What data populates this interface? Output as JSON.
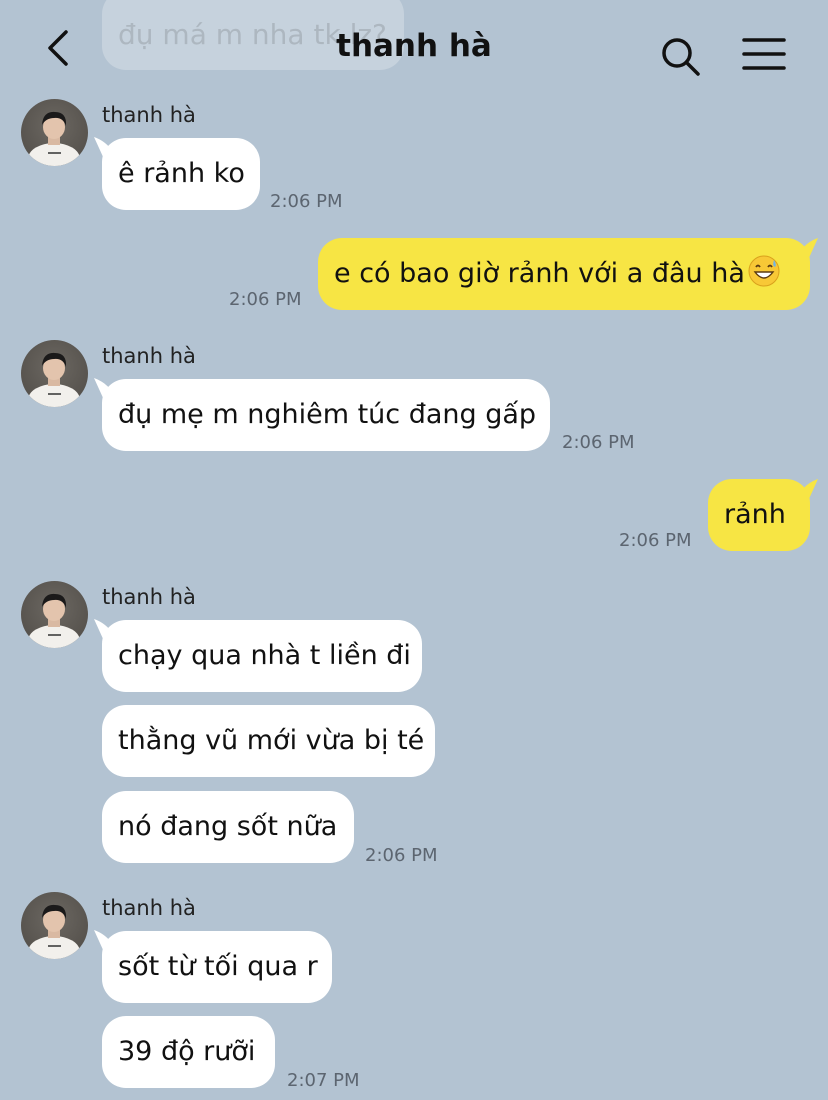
{
  "header": {
    "title": "thanh hà",
    "back_icon": "chevron-left-icon",
    "search_icon": "search-icon",
    "menu_icon": "hamburger-menu-icon",
    "ghost_message": "đụ má m nha tk lz?"
  },
  "colors": {
    "background": "#b3c3d2",
    "incoming_bubble": "#ffffff",
    "outgoing_bubble": "#f7e544",
    "timestamp": "#5c6570"
  },
  "messages": [
    {
      "sender": "thanh hà",
      "text": "ê rảnh ko",
      "time": "2:06 PM"
    },
    {
      "text": "e có bao giờ rảnh với a đâu hà",
      "emoji": "grinning-sweat-emoji",
      "time": "2:06 PM"
    },
    {
      "sender": "thanh hà",
      "text": "đụ mẹ m nghiêm túc đang gấp",
      "time": "2:06 PM"
    },
    {
      "text": "rảnh",
      "time": "2:06 PM"
    },
    {
      "sender": "thanh hà",
      "text": "chạy qua nhà t liền đi"
    },
    {
      "text": "thằng vũ mới vừa bị té"
    },
    {
      "text": "nó đang sốt nữa",
      "time": "2:06 PM"
    },
    {
      "sender": "thanh hà",
      "text": "sốt từ tối qua r"
    },
    {
      "text": "39 độ rưỡi",
      "time": "2:07 PM"
    }
  ]
}
